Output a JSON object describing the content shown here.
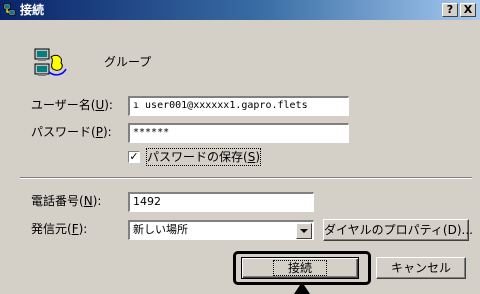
{
  "window": {
    "title": "接続",
    "help_button": "?",
    "close_button": "X"
  },
  "group": {
    "name": "グループ"
  },
  "form": {
    "username_label": "ユーザー名",
    "username_key": "U",
    "username_value": "ı user001@xxxxxx1.gapro.flets",
    "password_label": "パスワード",
    "password_key": "P",
    "password_value": "******",
    "save_password_label": "パスワードの保存",
    "save_password_key": "S",
    "save_password_checked": true,
    "phone_label": "電話番号",
    "phone_key": "N",
    "phone_value": "1492",
    "origin_label": "発信元",
    "origin_key": "F",
    "origin_value": "新しい場所",
    "dial_properties_button": "ダイヤルのプロパティ(D)..."
  },
  "buttons": {
    "connect": "接続",
    "cancel": "キャンセル"
  },
  "icons": {
    "title": "network-connection-icon",
    "group": "network-computers-icon"
  }
}
